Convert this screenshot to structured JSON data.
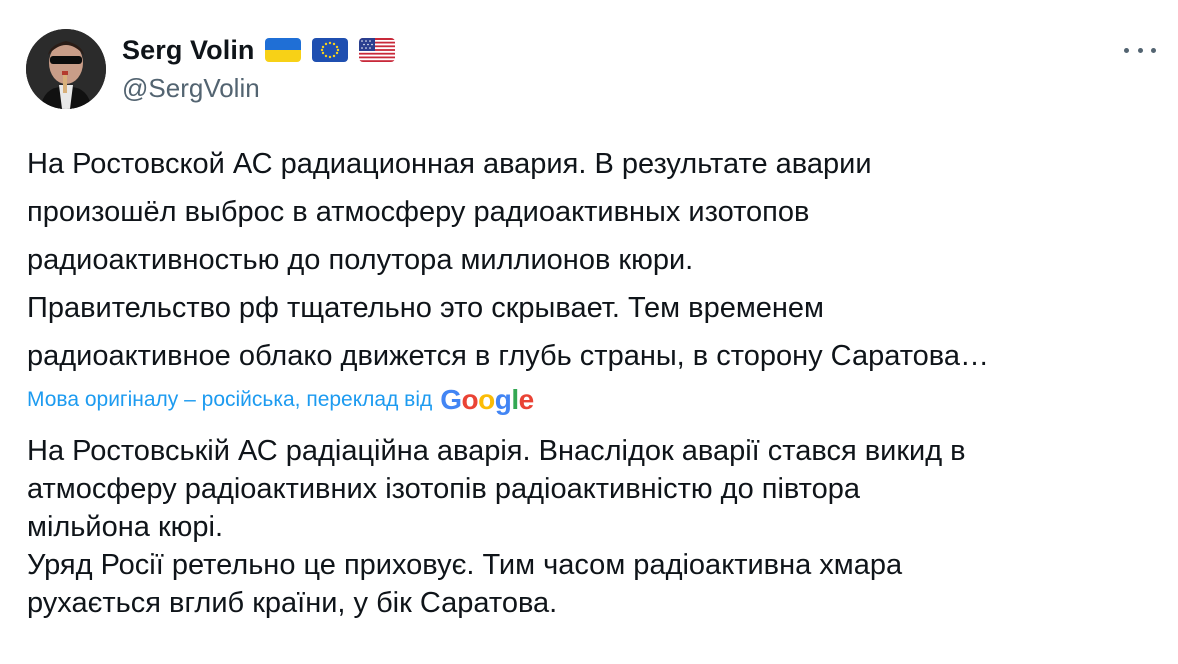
{
  "author": {
    "display_name": "Serg Volin",
    "handle": "@SergVolin",
    "flags": [
      "ukraine-flag-icon",
      "eu-flag-icon",
      "usa-flag-icon"
    ]
  },
  "more_icon": "more-horizontal-icon",
  "original_text": {
    "lines": [
      "На Ростовской АС радиационная авария. В результате аварии",
      "произошёл выброс в атмосферу радиоактивных изотопов",
      "радиоактивностью до полутора миллионов кюри.",
      "Правительство рф тщательно это скрывает. Тем временем",
      "радиоактивное облако движется в глубь страны, в сторону Саратова…"
    ]
  },
  "translation_note": {
    "label": "Мова оригіналу – російська, переклад від",
    "provider": "Google"
  },
  "translated_text": {
    "lines": [
      "На Ростовській АС радіаційна аварія. Внаслідок аварії стався викид в",
      "атмосферу радіоактивних ізотопів радіоактивністю до півтора",
      "мільйона кюрі.",
      "Уряд Росії ретельно це приховує. Тим часом радіоактивна хмара",
      "рухається вглиб країни, у бік Саратова."
    ]
  },
  "colors": {
    "text": "#0f1419",
    "secondary": "#536471",
    "link": "#1d9bf0"
  }
}
